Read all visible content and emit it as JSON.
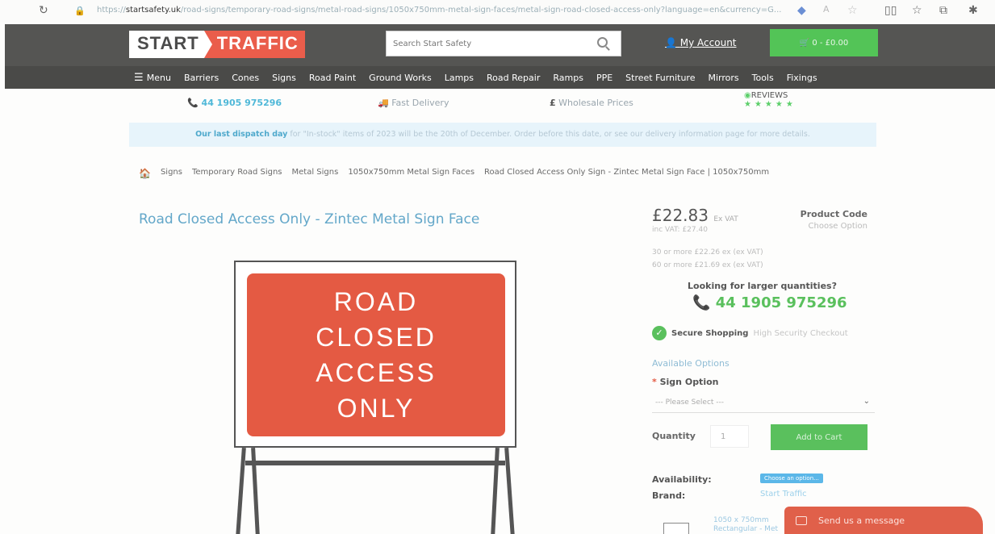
{
  "browser": {
    "url_domain": "startsafety.uk",
    "url_path": "/road-signs/temporary-road-signs/metal-road-signs/1050x750mm-metal-sign-faces/metal-sign-road-closed-access-only?language=en&currency=G..."
  },
  "header": {
    "logo_start": "START",
    "logo_traffic": "TRAFFIC",
    "search_placeholder": "Search Start Safety",
    "account_label": "My Account",
    "cart_label": "0 - £0.00"
  },
  "nav": {
    "items": [
      "Menu",
      "Barriers",
      "Cones",
      "Signs",
      "Road Paint",
      "Ground Works",
      "Lamps",
      "Road Repair",
      "Ramps",
      "PPE",
      "Street Furniture",
      "Mirrors",
      "Tools",
      "Fixings"
    ]
  },
  "trust": {
    "phone": "44 1905 975296",
    "delivery": "Fast Delivery",
    "prices": "Wholesale Prices",
    "reviews_label": "REVIEWS",
    "stars": "★★★★★"
  },
  "notice": {
    "bold": "Our last dispatch day",
    "text": " for \"In-stock\" items of 2023 will be the 20th of December. Order before this date, or see our delivery information page for more details."
  },
  "breadcrumb": [
    "Signs",
    "Temporary Road Signs",
    "Metal Signs",
    "1050x750mm Metal Sign Faces",
    "Road Closed Access Only Sign - Zintec Metal Sign Face | 1050x750mm"
  ],
  "product": {
    "title": "Road Closed Access Only - Zintec Metal Sign Face",
    "sign_lines": [
      "ROAD",
      "CLOSED",
      "ACCESS",
      "ONLY"
    ],
    "price": "£22.83",
    "price_suffix": "Ex VAT",
    "inc_vat": "inc VAT: £27.40",
    "product_code_label": "Product Code",
    "product_code_value": "Choose Option",
    "bulk_30": "30 or more £22.26 ex (ex VAT)",
    "bulk_60": "60 or more £21.69 ex (ex VAT)",
    "larger_qty": "Looking for larger quantities?",
    "big_phone": "44 1905 975296",
    "secure_bold": "Secure Shopping",
    "secure_sub": "High Security Checkout",
    "available_options": "Available Options",
    "sign_option_label": "Sign Option",
    "select_placeholder": "--- Please Select ---",
    "quantity_label": "Quantity",
    "quantity_value": "1",
    "add_to_cart": "Add to Cart",
    "availability_label": "Availability:",
    "availability_badge": "Choose an option...",
    "brand_label": "Brand:",
    "brand_value": "Start Traffic",
    "thumb_text_1": "1050 x 750mm",
    "thumb_text_2": "Rectangular - Met"
  },
  "chat": {
    "label": "Send us a message"
  }
}
